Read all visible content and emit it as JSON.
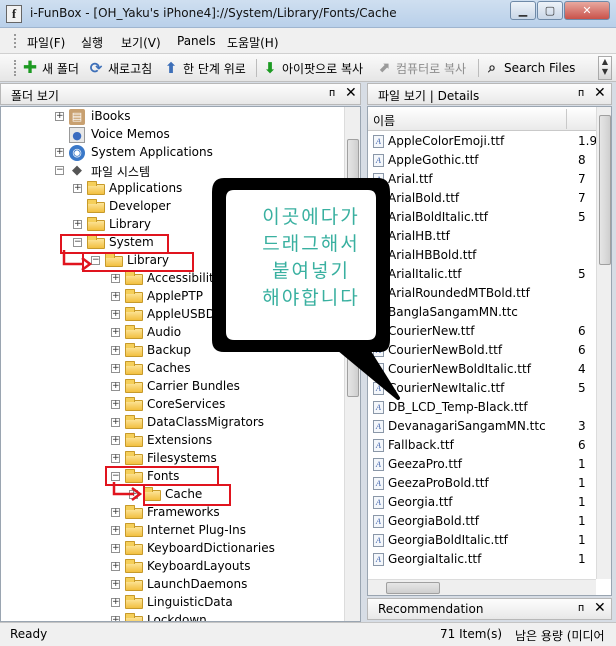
{
  "window": {
    "title": "i-FunBox - [OH_Yaku's iPhone4]://System/Library/Fonts/Cache",
    "app_icon_glyph": "f",
    "min_glyph": "▁",
    "max_glyph": "▢",
    "close_glyph": "✕"
  },
  "menu": {
    "items": [
      "파일(F)",
      "실행",
      "보기(V)",
      "Panels",
      "도움말(H)"
    ]
  },
  "toolbar": {
    "new_folder": "새 폴더",
    "refresh": "새로고침",
    "up_level": "한 단계 위로",
    "copy_to_device": "아이팟으로 복사",
    "copy_to_pc": "컴퓨터로 복사",
    "search": "Search Files",
    "icons": {
      "new_folder": "plus-icon",
      "refresh": "refresh-icon",
      "up_level": "arrow-up-icon",
      "copy_to_device": "arrow-down-icon",
      "copy_to_pc": "copy-icon",
      "search": "magnifier-icon"
    }
  },
  "left_panel": {
    "title": "폴더 보기",
    "pin": "ᴨ",
    "close": "✕"
  },
  "right_panel": {
    "title": "파일 보기 | Details",
    "pin": "ᴨ",
    "close": "✕",
    "column_name": "이름"
  },
  "tree": [
    {
      "label": "iBooks",
      "icon": "ibooks-icon"
    },
    {
      "label": "Voice Memos",
      "icon": "voice-memos-icon"
    },
    {
      "label": "System Applications",
      "icon": "system-apps-icon"
    },
    {
      "label": "파일 시스템",
      "icon": "filesystem-icon"
    },
    {
      "label": "Applications",
      "icon": "folder-icon"
    },
    {
      "label": "Developer",
      "icon": "folder-icon"
    },
    {
      "label": "Library",
      "icon": "folder-icon"
    },
    {
      "label": "System",
      "icon": "folder-icon"
    },
    {
      "label": "Library",
      "icon": "folder-icon"
    },
    {
      "label": "Accessibility",
      "icon": "folder-icon"
    },
    {
      "label": "ApplePTP",
      "icon": "folder-icon"
    },
    {
      "label": "AppleUSBDe",
      "icon": "folder-icon"
    },
    {
      "label": "Audio",
      "icon": "folder-icon"
    },
    {
      "label": "Backup",
      "icon": "folder-icon"
    },
    {
      "label": "Caches",
      "icon": "folder-icon"
    },
    {
      "label": "Carrier Bundles",
      "icon": "folder-icon"
    },
    {
      "label": "CoreServices",
      "icon": "folder-icon"
    },
    {
      "label": "DataClassMigrators",
      "icon": "folder-icon"
    },
    {
      "label": "Extensions",
      "icon": "folder-icon"
    },
    {
      "label": "Filesystems",
      "icon": "folder-icon"
    },
    {
      "label": "Fonts",
      "icon": "folder-icon"
    },
    {
      "label": "Cache",
      "icon": "folder-icon"
    },
    {
      "label": "Frameworks",
      "icon": "folder-icon"
    },
    {
      "label": "Internet Plug-Ins",
      "icon": "folder-icon"
    },
    {
      "label": "KeyboardDictionaries",
      "icon": "folder-icon"
    },
    {
      "label": "KeyboardLayouts",
      "icon": "folder-icon"
    },
    {
      "label": "LaunchDaemons",
      "icon": "folder-icon"
    },
    {
      "label": "LinguisticData",
      "icon": "folder-icon"
    },
    {
      "label": "Lockdown",
      "icon": "folder-icon"
    }
  ],
  "files": [
    {
      "name": "AppleColorEmoji.ttf",
      "size": "1.9"
    },
    {
      "name": "AppleGothic.ttf",
      "size": "8"
    },
    {
      "name": "Arial.ttf",
      "size": "7"
    },
    {
      "name": "ArialBold.ttf",
      "size": "7"
    },
    {
      "name": "ArialBoldItalic.ttf",
      "size": "5"
    },
    {
      "name": "ArialHB.ttf",
      "size": ""
    },
    {
      "name": "ArialHBBold.ttf",
      "size": ""
    },
    {
      "name": "ArialItalic.ttf",
      "size": "5"
    },
    {
      "name": "ArialRoundedMTBold.ttf",
      "size": ""
    },
    {
      "name": "BanglaSangamMN.ttc",
      "size": ""
    },
    {
      "name": "CourierNew.ttf",
      "size": "6"
    },
    {
      "name": "CourierNewBold.ttf",
      "size": "6"
    },
    {
      "name": "CourierNewBoldItalic.ttf",
      "size": "4"
    },
    {
      "name": "CourierNewItalic.ttf",
      "size": "5"
    },
    {
      "name": "DB_LCD_Temp-Black.ttf",
      "size": ""
    },
    {
      "name": "DevanagariSangamMN.ttc",
      "size": "3"
    },
    {
      "name": "Fallback.ttf",
      "size": "6"
    },
    {
      "name": "GeezaPro.ttf",
      "size": "1"
    },
    {
      "name": "GeezaProBold.ttf",
      "size": "1"
    },
    {
      "name": "Georgia.ttf",
      "size": "1"
    },
    {
      "name": "GeorgiaBold.ttf",
      "size": "1"
    },
    {
      "name": "GeorgiaBoldItalic.ttf",
      "size": "1"
    },
    {
      "name": "GeorgiaItalic.ttf",
      "size": "1"
    }
  ],
  "recommendation": {
    "title": "Recommendation",
    "pin": "ᴨ",
    "close": "✕"
  },
  "status": {
    "left": "Ready",
    "items": "71 Item(s)",
    "space": "남은 용량 (미디어"
  },
  "annotation": {
    "lines": [
      "이곳에다가",
      "드래그해서",
      "붙여넣기",
      "해야합니다"
    ],
    "color": "#39b0a0",
    "highlight_color": "#e0141e"
  },
  "expander": {
    "plus": "+",
    "minus": "−"
  }
}
